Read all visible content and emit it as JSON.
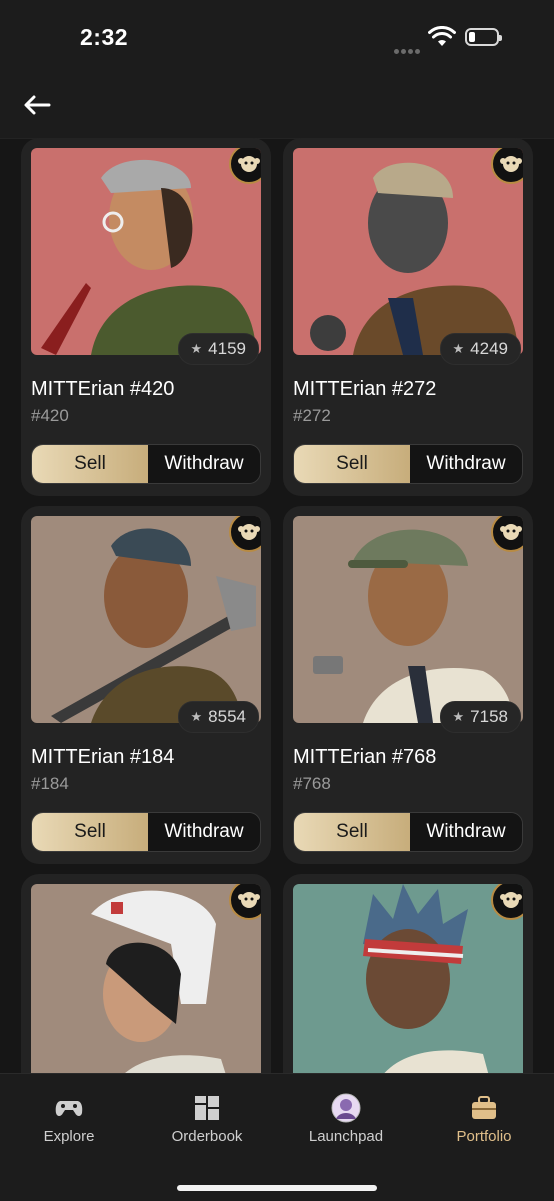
{
  "status": {
    "time": "2:32"
  },
  "cards": [
    {
      "title": "MITTErian #420",
      "sub": "#420",
      "rank": "4159",
      "sell": "Sell",
      "withdraw": "Withdraw"
    },
    {
      "title": "MITTErian #272",
      "sub": "#272",
      "rank": "4249",
      "sell": "Sell",
      "withdraw": "Withdraw"
    },
    {
      "title": "MITTErian #184",
      "sub": "#184",
      "rank": "8554",
      "sell": "Sell",
      "withdraw": "Withdraw"
    },
    {
      "title": "MITTErian #768",
      "sub": "#768",
      "rank": "7158",
      "sell": "Sell",
      "withdraw": "Withdraw"
    },
    {
      "title": "",
      "sub": "",
      "rank": "",
      "sell": "",
      "withdraw": ""
    },
    {
      "title": "",
      "sub": "",
      "rank": "",
      "sell": "",
      "withdraw": ""
    }
  ],
  "tabs": [
    {
      "label": "Explore",
      "icon": "gamepad-icon"
    },
    {
      "label": "Orderbook",
      "icon": "grid-icon"
    },
    {
      "label": "Launchpad",
      "icon": "avatar-icon"
    },
    {
      "label": "Portfolio",
      "icon": "briefcase-icon",
      "active": true
    }
  ],
  "colors": {
    "accent": "#e0bf8a",
    "card_bg": "#232323",
    "page_bg": "#161616",
    "sell_gradient_start": "#e9d9b6",
    "sell_gradient_end": "#c7ad7b"
  }
}
